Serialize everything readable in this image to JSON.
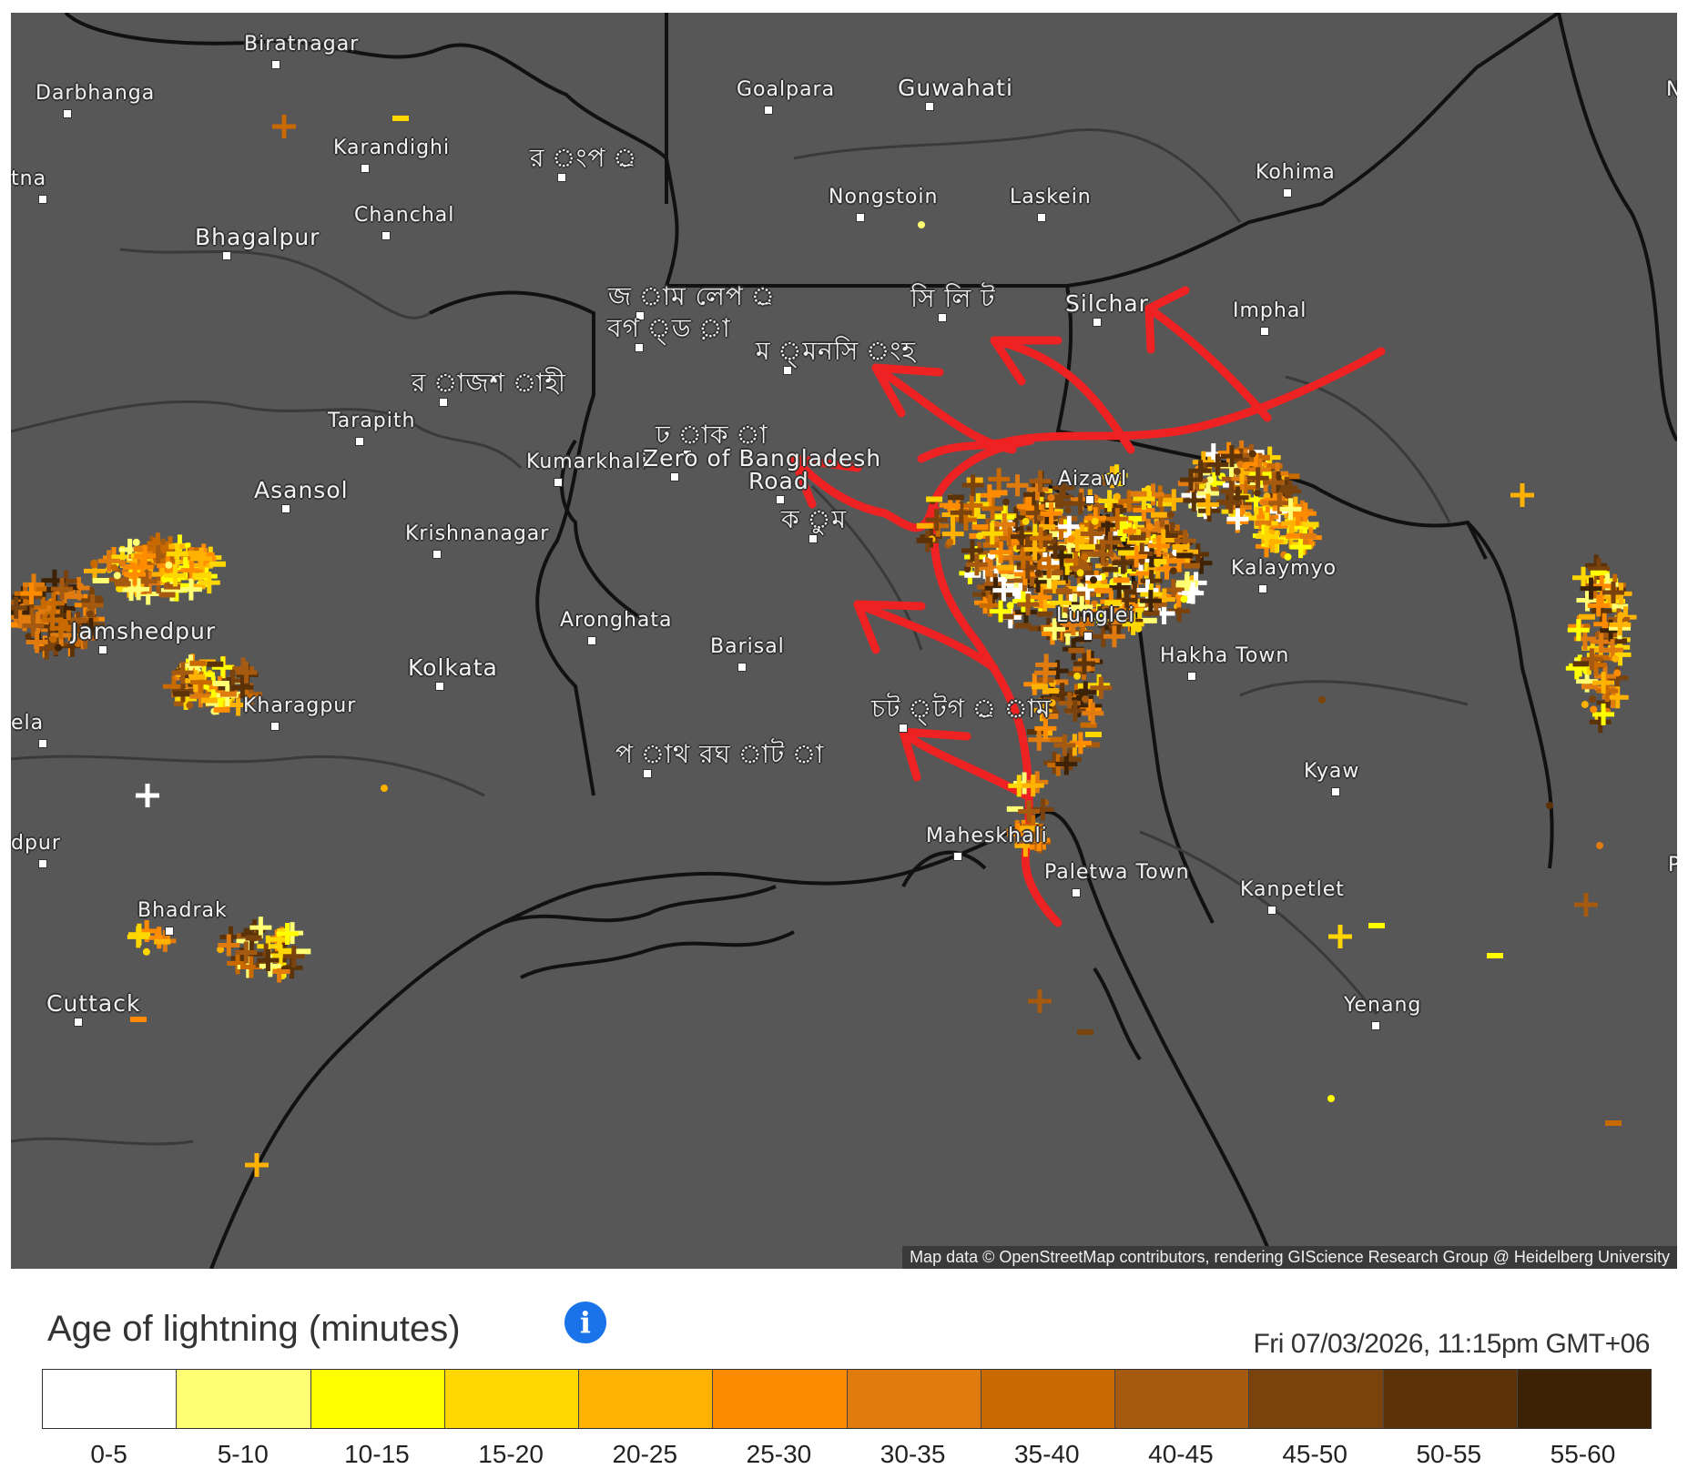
{
  "map": {
    "attribution": "Map data © OpenStreetMap contributors, rendering GIScience Research Group @ Heidelberg University",
    "colors": {
      "land": "#575757",
      "borders": "#111111",
      "annotation": "#ee2222"
    },
    "places": [
      {
        "name": "Biratnagar",
        "style": "normal"
      },
      {
        "name": "Darbhanga",
        "style": "normal"
      },
      {
        "name": "Goalpara",
        "style": "normal"
      },
      {
        "name": "Guwahati",
        "style": "big"
      },
      {
        "name": "Karandighi",
        "style": "normal"
      },
      {
        "name": "র ংপ ্র",
        "style": "bn"
      },
      {
        "name": "Chanchal",
        "style": "normal"
      },
      {
        "name": "Nongstoin",
        "style": "normal"
      },
      {
        "name": "Laskein",
        "style": "normal"
      },
      {
        "name": "Kohima",
        "style": "normal"
      },
      {
        "name": "Bhagalpur",
        "style": "big"
      },
      {
        "name": "জ াম লেপ ্র",
        "style": "bn"
      },
      {
        "name": "সি লি ট",
        "style": "bn"
      },
      {
        "name": "Silchar",
        "style": "big"
      },
      {
        "name": "Imphal",
        "style": "normal"
      },
      {
        "name": "বগ ্ড ়া",
        "style": "bn"
      },
      {
        "name": "ম ্মনসি ংহ",
        "style": "bn"
      },
      {
        "name": "র াজশ াহী",
        "style": "bn"
      },
      {
        "name": "Tarapith",
        "style": "normal"
      },
      {
        "name": "ঢ াক া",
        "style": "bn"
      },
      {
        "name": "Kumarkhali",
        "style": "normal"
      },
      {
        "name": "Zero of Bangladesh",
        "style": "big"
      },
      {
        "name": "Road",
        "style": "big"
      },
      {
        "name": "Aizawl",
        "style": "normal"
      },
      {
        "name": "Asansol",
        "style": "big"
      },
      {
        "name": "Krishnanagar",
        "style": "normal"
      },
      {
        "name": "ক ুম",
        "style": "bn"
      },
      {
        "name": "Kalaymyo",
        "style": "normal"
      },
      {
        "name": "Lunglei",
        "style": "normal"
      },
      {
        "name": "Jamshedpur",
        "style": "big"
      },
      {
        "name": "Aronghata",
        "style": "normal"
      },
      {
        "name": "Hakha Town",
        "style": "normal"
      },
      {
        "name": "Barisal",
        "style": "normal"
      },
      {
        "name": "Kolkata",
        "style": "big"
      },
      {
        "name": "Kharagpur",
        "style": "normal"
      },
      {
        "name": "চট ্টগ ্র াম",
        "style": "bn"
      },
      {
        "name": "প াথ রঘ াট া",
        "style": "bn"
      },
      {
        "name": "Kyaw",
        "style": "normal"
      },
      {
        "name": "Maheskhali",
        "style": "normal"
      },
      {
        "name": "Paletwa Town",
        "style": "normal"
      },
      {
        "name": "Kanpetlet",
        "style": "normal"
      },
      {
        "name": "Bhadrak",
        "style": "normal"
      },
      {
        "name": "Cuttack",
        "style": "big"
      },
      {
        "name": "Yenang",
        "style": "normal"
      },
      {
        "name": "tna",
        "style": "normal"
      },
      {
        "name": "ela",
        "style": "normal"
      },
      {
        "name": "dpur",
        "style": "normal"
      },
      {
        "name": "Na",
        "style": "normal"
      },
      {
        "name": "Pa",
        "style": "normal"
      }
    ]
  },
  "legend": {
    "title": "Age of lightning (minutes)",
    "info_icon": "info-icon",
    "timestamp": "Fri 07/03/2026, 11:15pm GMT+06",
    "bins": [
      {
        "label": "0-5",
        "color": "#ffffff"
      },
      {
        "label": "5-10",
        "color": "#ffff73"
      },
      {
        "label": "10-15",
        "color": "#ffff00"
      },
      {
        "label": "15-20",
        "color": "#ffd700"
      },
      {
        "label": "20-25",
        "color": "#ffb300"
      },
      {
        "label": "25-30",
        "color": "#ff8c00"
      },
      {
        "label": "30-35",
        "color": "#e07b10"
      },
      {
        "label": "35-40",
        "color": "#c86a00"
      },
      {
        "label": "40-45",
        "color": "#a65a10"
      },
      {
        "label": "45-50",
        "color": "#7a420c"
      },
      {
        "label": "50-55",
        "color": "#5c3208"
      },
      {
        "label": "55-60",
        "color": "#3d2205"
      }
    ]
  }
}
